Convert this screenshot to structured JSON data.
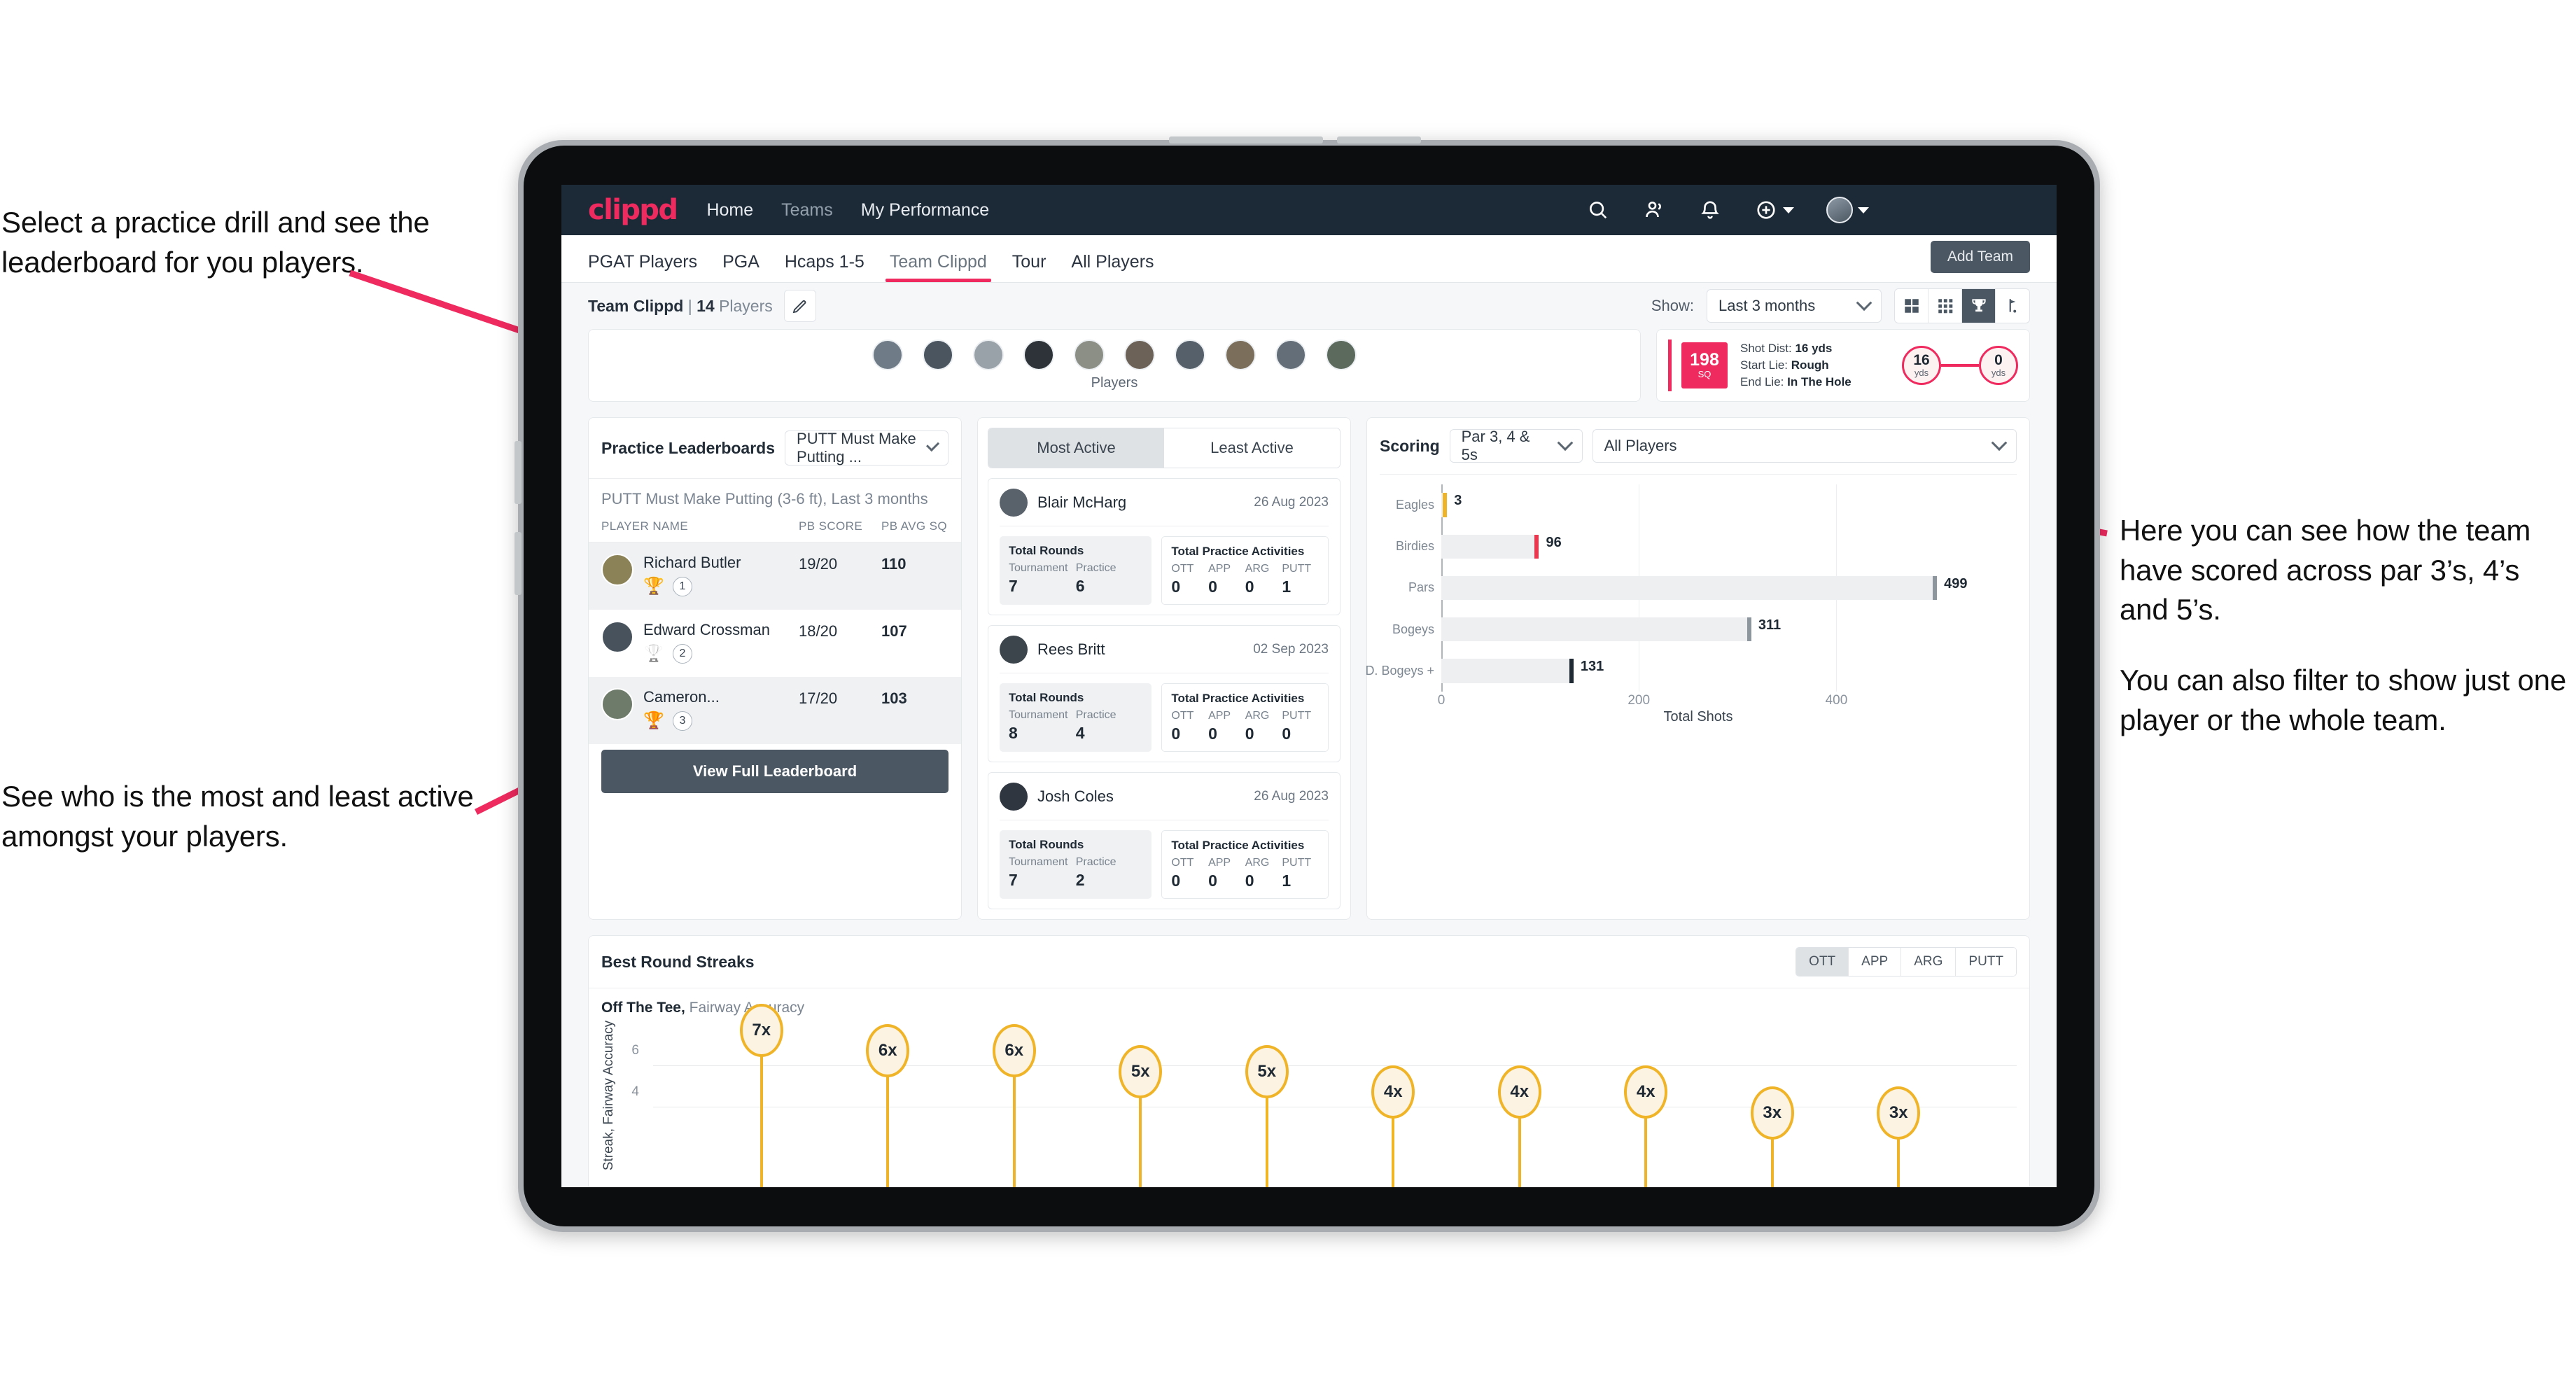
{
  "annotations": {
    "left_top": "Select a practice drill and see the leaderboard for you players.",
    "left_bottom": "See who is the most and least active amongst your players.",
    "right_1": "Here you can see how the team have scored across par 3’s, 4’s and 5’s.",
    "right_2": "You can also filter to show just one player or the whole team."
  },
  "navbar": {
    "logo": "clippd",
    "links": [
      {
        "label": "Home",
        "active": true
      },
      {
        "label": "Teams",
        "active": false
      },
      {
        "label": "My Performance",
        "active": true
      }
    ],
    "icons": [
      "search-icon",
      "people-icon",
      "bell-icon",
      "plus-circle-icon",
      "avatar"
    ]
  },
  "tabs": [
    {
      "label": "PGAT Players",
      "active": false
    },
    {
      "label": "PGA",
      "active": false
    },
    {
      "label": "Hcaps 1-5",
      "active": false
    },
    {
      "label": "Team Clippd",
      "active": true
    },
    {
      "label": "Tour",
      "active": false
    },
    {
      "label": "All Players",
      "active": false
    }
  ],
  "add_team_button": "Add Team",
  "subheader": {
    "team_name": "Team Clippd",
    "separator": "|",
    "player_count": "14",
    "players_word": "Players",
    "edit_icon": "pencil-icon",
    "show_label": "Show:",
    "range_value": "Last 3 months",
    "view_toggles": [
      {
        "icon": "grid-large-icon",
        "active": false
      },
      {
        "icon": "grid-small-icon",
        "active": false
      },
      {
        "icon": "trophy-icon",
        "active": true
      },
      {
        "icon": "flag-icon",
        "active": false
      }
    ]
  },
  "players_strip": {
    "label": "Players",
    "avatar_count": 10
  },
  "shot_card": {
    "sq_value": "198",
    "sq_unit": "SQ",
    "lines": [
      {
        "key": "Shot Dist:",
        "value": "16 yds"
      },
      {
        "key": "Start Lie:",
        "value": "Rough"
      },
      {
        "key": "End Lie:",
        "value": "In The Hole"
      }
    ],
    "start_circle": {
      "value": "16",
      "unit": "yds"
    },
    "end_circle": {
      "value": "0",
      "unit": "yds"
    }
  },
  "practice_leaderboard": {
    "title": "Practice Leaderboards",
    "drill_select": "PUTT Must Make Putting ...",
    "subtitle_bold": "PUTT Must Make Putting (3-6 ft),",
    "subtitle_muted": "Last 3 months",
    "columns": [
      "PLAYER NAME",
      "PB SCORE",
      "PB AVG SQ"
    ],
    "rows": [
      {
        "name": "Richard Butler",
        "rank": "1",
        "medal": "gold",
        "pb_score": "19/20",
        "pb_avg_sq": "110"
      },
      {
        "name": "Edward Crossman",
        "rank": "2",
        "medal": "silver",
        "pb_score": "18/20",
        "pb_avg_sq": "107"
      },
      {
        "name": "Cameron...",
        "rank": "3",
        "medal": "bronze",
        "pb_score": "17/20",
        "pb_avg_sq": "103"
      }
    ],
    "button": "View Full Leaderboard"
  },
  "activity": {
    "tabs": [
      {
        "label": "Most Active",
        "active": true
      },
      {
        "label": "Least Active",
        "active": false
      }
    ],
    "rounds_title": "Total Rounds",
    "rounds_keys": [
      "Tournament",
      "Practice"
    ],
    "practice_title": "Total Practice Activities",
    "practice_keys": [
      "OTT",
      "APP",
      "ARG",
      "PUTT"
    ],
    "items": [
      {
        "name": "Blair McHarg",
        "date": "26 Aug 2023",
        "tournament": "7",
        "practice": "6",
        "ott": "0",
        "app": "0",
        "arg": "0",
        "putt": "1"
      },
      {
        "name": "Rees Britt",
        "date": "02 Sep 2023",
        "tournament": "8",
        "practice": "4",
        "ott": "0",
        "app": "0",
        "arg": "0",
        "putt": "0"
      },
      {
        "name": "Josh Coles",
        "date": "26 Aug 2023",
        "tournament": "7",
        "practice": "2",
        "ott": "0",
        "app": "0",
        "arg": "0",
        "putt": "1"
      }
    ]
  },
  "scoring": {
    "title": "Scoring",
    "par_filter": "Par 3, 4 & 5s",
    "player_filter": "All Players"
  },
  "streaks": {
    "title": "Best Round Streaks",
    "toggles": [
      {
        "label": "OTT",
        "active": true
      },
      {
        "label": "APP",
        "active": false
      },
      {
        "label": "ARG",
        "active": false
      },
      {
        "label": "PUTT",
        "active": false
      }
    ],
    "subtitle_bold": "Off The Tee,",
    "subtitle_muted": "Fairway Accuracy"
  },
  "colors": {
    "brand_pink": "#ef2a5f",
    "navy": "#1c2a38",
    "slate": "#4b5763",
    "amber": "#f0b429"
  },
  "chart_data": [
    {
      "type": "bar",
      "id": "scoring-distribution",
      "orientation": "horizontal",
      "title": "Scoring",
      "categories": [
        "Eagles",
        "Birdies",
        "Pars",
        "Bogeys",
        "D. Bogeys +"
      ],
      "values": [
        3,
        96,
        499,
        311,
        131
      ],
      "cap_colors": [
        "#f0b429",
        "#e8384f",
        "#8d959d",
        "#8d959d",
        "#1f2933"
      ],
      "xlabel": "Total Shots",
      "ylabel": "",
      "xticks": [
        0,
        200,
        400
      ],
      "xlim": [
        0,
        540
      ],
      "grid": true,
      "legend": false
    },
    {
      "type": "bar",
      "id": "best-round-streaks",
      "orientation": "vertical-lollipop",
      "title": "Best Round Streaks",
      "subtitle": "Off The Tee, Fairway Accuracy",
      "categories": [
        "",
        "",
        "",
        "",
        "",
        "",
        "",
        "",
        "",
        ""
      ],
      "values": [
        7,
        6,
        6,
        5,
        5,
        4,
        4,
        4,
        3,
        3
      ],
      "labels": [
        "7x",
        "6x",
        "6x",
        "5x",
        "5x",
        "4x",
        "4x",
        "4x",
        "3x",
        "3x"
      ],
      "ylabel": "Streak, Fairway Accuracy",
      "yticks": [
        4,
        6
      ],
      "ylim": [
        0,
        8
      ],
      "grid": true,
      "legend": false
    }
  ]
}
